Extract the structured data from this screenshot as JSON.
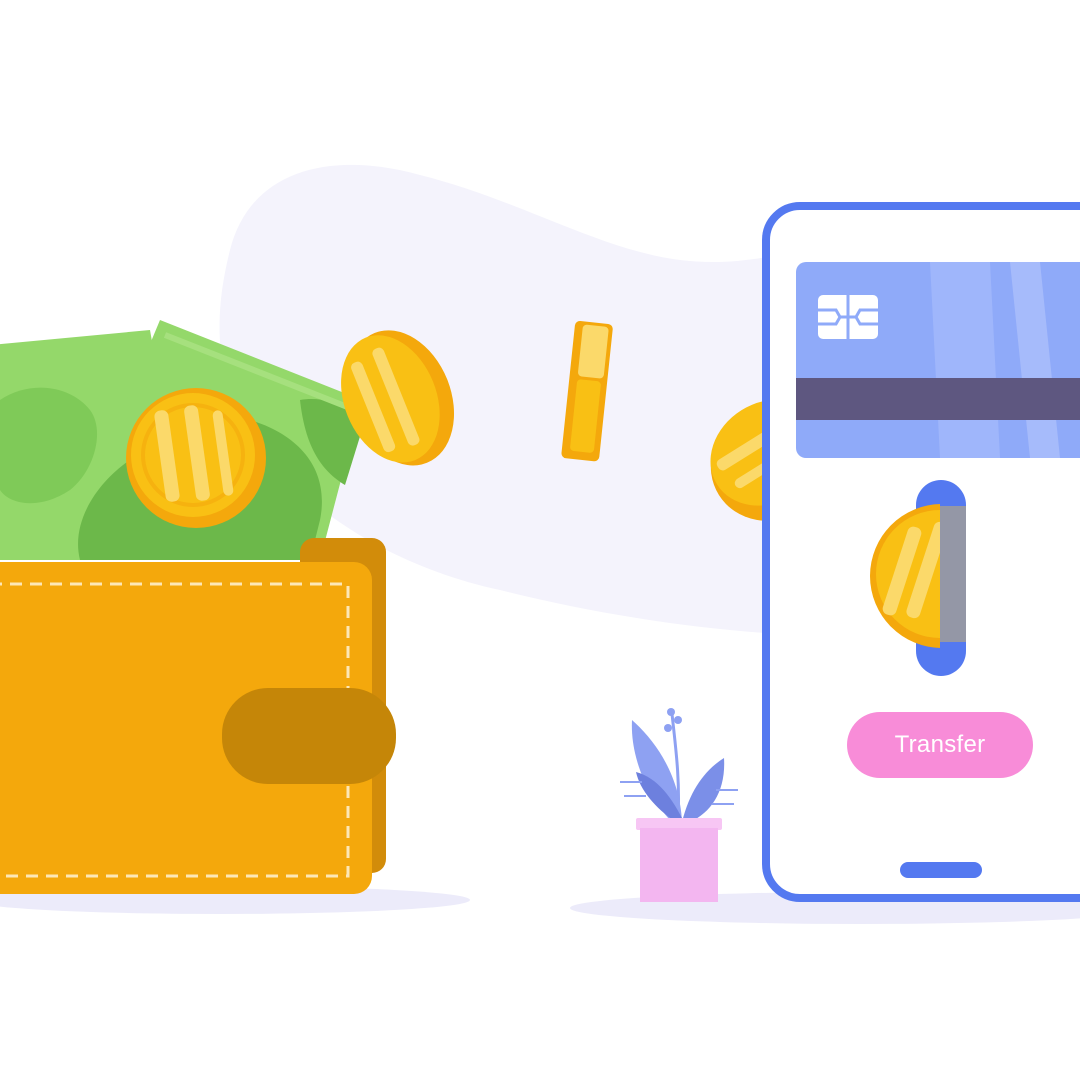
{
  "scene": {
    "colors": {
      "background": "#ffffff",
      "blob": "#f4f3fc",
      "ground_shadow": "#ecebfa",
      "wallet": "#f4a80c",
      "wallet_back": "#d28c0a",
      "wallet_strap": "#c58608",
      "cash_light": "#94d86a",
      "cash_dark": "#6cb84a",
      "coin_gold": "#f9c014",
      "coin_edge": "#f4a80c",
      "coin_shine": "#fbd96a",
      "phone_frame": "#5479f0",
      "card_blue": "#8faaf9",
      "card_stripe": "#5e5780",
      "slot": "#5479f0",
      "transfer_button": "#f88cd8",
      "plant_leaf": "#8ea1f2",
      "plant_pot": "#f3b6f0"
    },
    "icons": [
      "wallet-icon",
      "banknote-icon",
      "coin-icon",
      "smartphone-icon",
      "credit-card-icon",
      "chip-icon",
      "plant-icon"
    ]
  },
  "phone": {
    "transfer_button_label": "Transfer"
  }
}
